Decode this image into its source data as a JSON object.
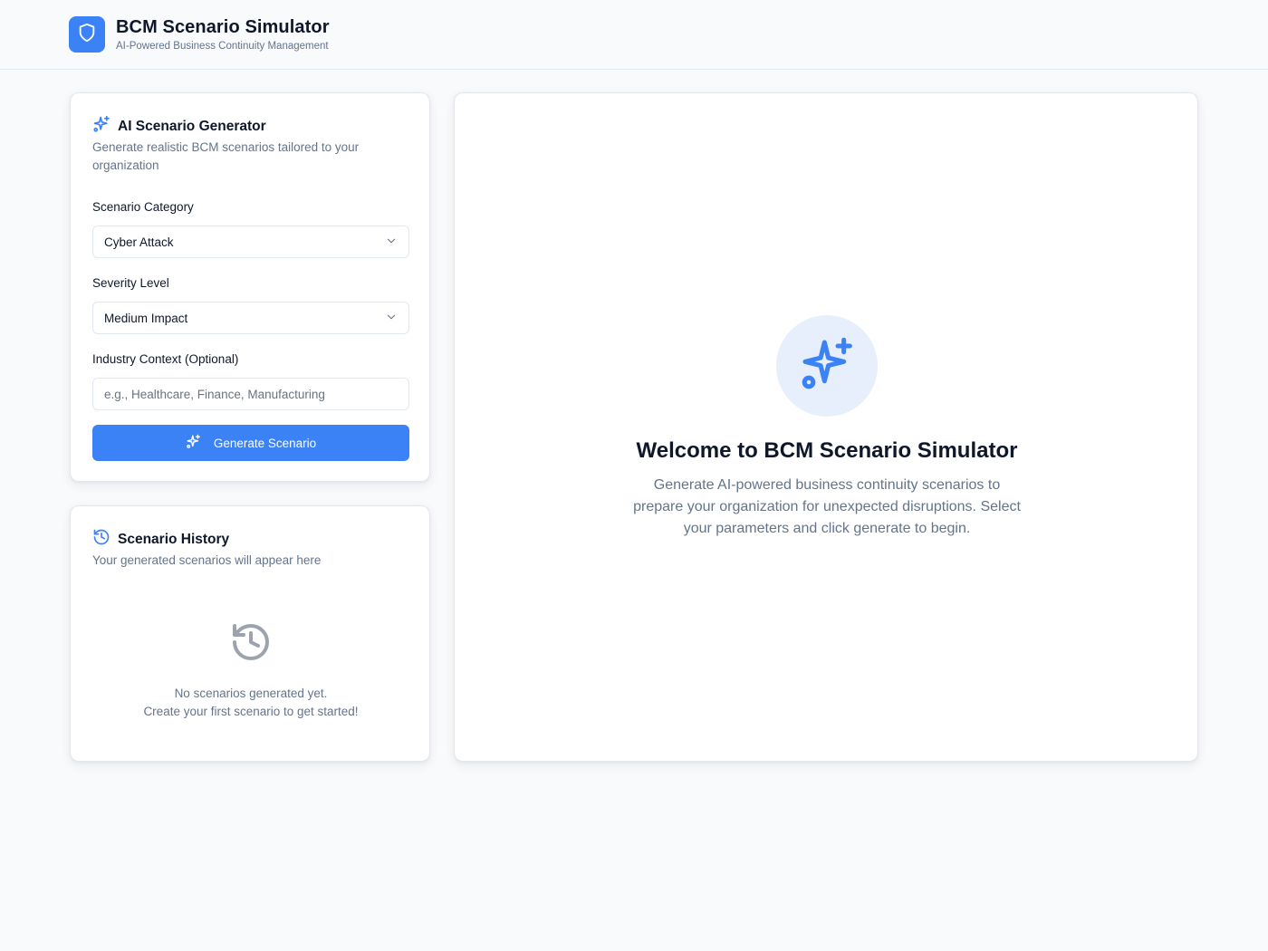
{
  "header": {
    "title": "BCM Scenario Simulator",
    "subtitle": "AI-Powered Business Continuity Management",
    "logo_icon": "shield-icon"
  },
  "generator": {
    "icon": "sparkles-icon",
    "title": "AI Scenario Generator",
    "description": "Generate realistic BCM scenarios tailored to your organization",
    "category": {
      "label": "Scenario Category",
      "value": "Cyber Attack"
    },
    "severity": {
      "label": "Severity Level",
      "value": "Medium Impact"
    },
    "industry": {
      "label": "Industry Context (Optional)",
      "value": "",
      "placeholder": "e.g., Healthcare, Finance, Manufacturing"
    },
    "button_label": "Generate Scenario"
  },
  "history": {
    "icon": "history-icon",
    "title": "Scenario History",
    "description": "Your generated scenarios will appear here",
    "empty_line1": "No scenarios generated yet.",
    "empty_line2": "Create your first scenario to get started!"
  },
  "welcome": {
    "icon": "sparkles-icon",
    "title": "Welcome to BCM Scenario Simulator",
    "text": "Generate AI-powered business continuity scenarios to prepare your organization for unexpected disruptions. Select your parameters and click generate to begin."
  },
  "colors": {
    "accent": "#3b82f6",
    "background": "#f8fafc",
    "muted_text": "#64748b"
  }
}
